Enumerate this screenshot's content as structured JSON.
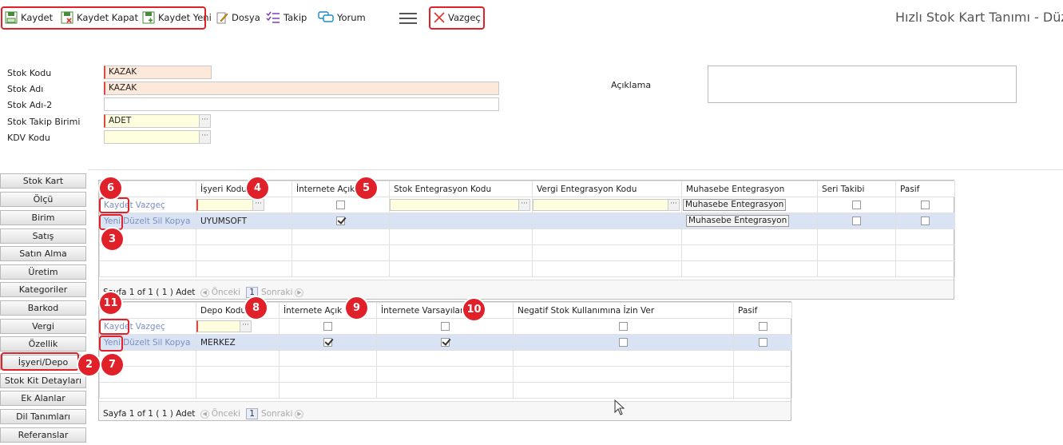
{
  "toolbar": {
    "save": "Kaydet",
    "save_close": "Kaydet Kapat",
    "save_new": "Kaydet Yeni",
    "file": "Dosya",
    "follow": "Takip",
    "comment": "Yorum",
    "cancel": "Vazgeç"
  },
  "page_title": "Hızlı Stok Kart Tanımı - Düze",
  "form": {
    "stock_code_label": "Stok Kodu",
    "stock_code_value": "KAZAK",
    "stock_name_label": "Stok Adı",
    "stock_name_value": "KAZAK",
    "stock_name2_label": "Stok Adı-2",
    "stock_name2_value": "",
    "unit_label": "Stok Takip Birimi",
    "unit_value": "ADET",
    "vat_label": "KDV Kodu",
    "vat_value": "",
    "description_label": "Açıklama"
  },
  "sidebar": {
    "items": [
      "Stok Kart",
      "Ölçü",
      "Birim",
      "Satış",
      "Satın Alma",
      "Üretim",
      "Kategoriler",
      "Barkod",
      "Vergi",
      "Özellik",
      "İşyeri/Depo",
      "Stok Kit Detayları",
      "Ek Alanlar",
      "Dil Tanımları",
      "Referanslar"
    ],
    "active": "İşyeri/Depo"
  },
  "grid1": {
    "headers": [
      "",
      "İşyeri Kodu",
      "İnternete Açık",
      "Stok Entegrasyon Kodu",
      "Vergi Entegrasyon Kodu",
      "Muhasebe Entegrasyon",
      "Seri Takibi",
      "Pasif"
    ],
    "edit_actions": {
      "save": "Kaydet",
      "cancel": "Vazgeç"
    },
    "row_actions": {
      "new": "Yeni",
      "edit": "Düzelt",
      "delete": "Sil",
      "copy": "Kopya"
    },
    "accounting_button": "Muhasebe Entegrasyon",
    "row": {
      "code": "UYUMSOFT",
      "internet_open": true,
      "serial": false,
      "passive": false
    },
    "pager": {
      "page_text": "Sayfa 1 of 1 ( 1 ) Adet",
      "prev": "Önceki",
      "page": "1",
      "next": "Sonraki"
    }
  },
  "grid2": {
    "headers": [
      "",
      "Depo Kodu",
      "İnternete Açık",
      "İnternete Varsayılan",
      "Negatif Stok Kullanımına İzin Ver",
      "Pasif"
    ],
    "edit_actions": {
      "save": "Kaydet",
      "cancel": "Vazgeç"
    },
    "row_actions": {
      "new": "Yeni",
      "edit": "Düzelt",
      "delete": "Sil",
      "copy": "Kopya"
    },
    "row": {
      "code": "MERKEZ",
      "internet_open": true,
      "internet_default": true,
      "negative_stock": false,
      "passive": false
    },
    "pager": {
      "page_text": "Sayfa 1 of 1 ( 1 ) Adet",
      "prev": "Önceki",
      "page": "1",
      "next": "Sonraki"
    }
  },
  "badges": [
    "2",
    "3",
    "4",
    "5",
    "6",
    "7",
    "8",
    "9",
    "10",
    "11"
  ],
  "colors": {
    "highlight": "#e0212a",
    "selected_row": "#d9e3f3",
    "required_bg": "#fde9d9",
    "lookup_bg": "#ffffe0"
  }
}
